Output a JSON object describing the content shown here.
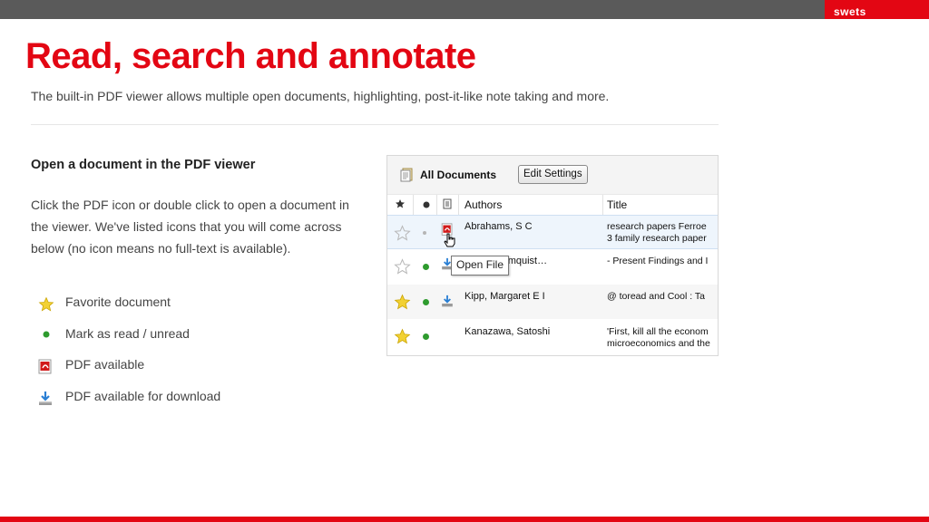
{
  "header": {
    "brand": "swets"
  },
  "slide": {
    "title": "Read, search and annotate",
    "subtitle": "The built-in PDF viewer allows multiple open documents, highlighting, post-it-like note taking and more.",
    "section_heading": "Open a document in the PDF viewer",
    "section_body": "Click the PDF icon or double click to open a document in the viewer. We've listed icons that you will come across below (no icon means no full-text is available).",
    "legend": [
      {
        "icon": "star-icon",
        "label": "Favorite document"
      },
      {
        "icon": "green-dot-icon",
        "label": "Mark as read / unread"
      },
      {
        "icon": "pdf-icon",
        "label": "PDF available"
      },
      {
        "icon": "download-icon",
        "label": "PDF available for download"
      }
    ]
  },
  "app": {
    "title": "All Documents",
    "edit_button": "Edit Settings",
    "columns": {
      "authors": "Authors",
      "title": "Title"
    },
    "tooltip": "Open File",
    "rows": [
      {
        "favorite": false,
        "read_dot": "grey",
        "file_icon": "pdf",
        "authors": "Abrahams, S C",
        "title_line1": "research papers Ferroe",
        "title_line2": "3 family research paper"
      },
      {
        "favorite": false,
        "read_dot": "green",
        "file_icon": "download",
        "authors": "Tobias; Elmquist…",
        "title_line1": "- Present Findings and I",
        "title_line2": ""
      },
      {
        "favorite": true,
        "read_dot": "green",
        "file_icon": "download",
        "authors": "Kipp, Margaret E I",
        "title_line1": "@ toread and Cool : Ta",
        "title_line2": ""
      },
      {
        "favorite": true,
        "read_dot": "green",
        "file_icon": "none",
        "authors": "Kanazawa, Satoshi",
        "title_line1": "'First, kill all the econom",
        "title_line2": "microeconomics and the"
      }
    ]
  },
  "colors": {
    "accent": "#e30613",
    "topbar": "#5a5a5a",
    "star": "#f2d133",
    "dot": "#2e9b2e"
  }
}
